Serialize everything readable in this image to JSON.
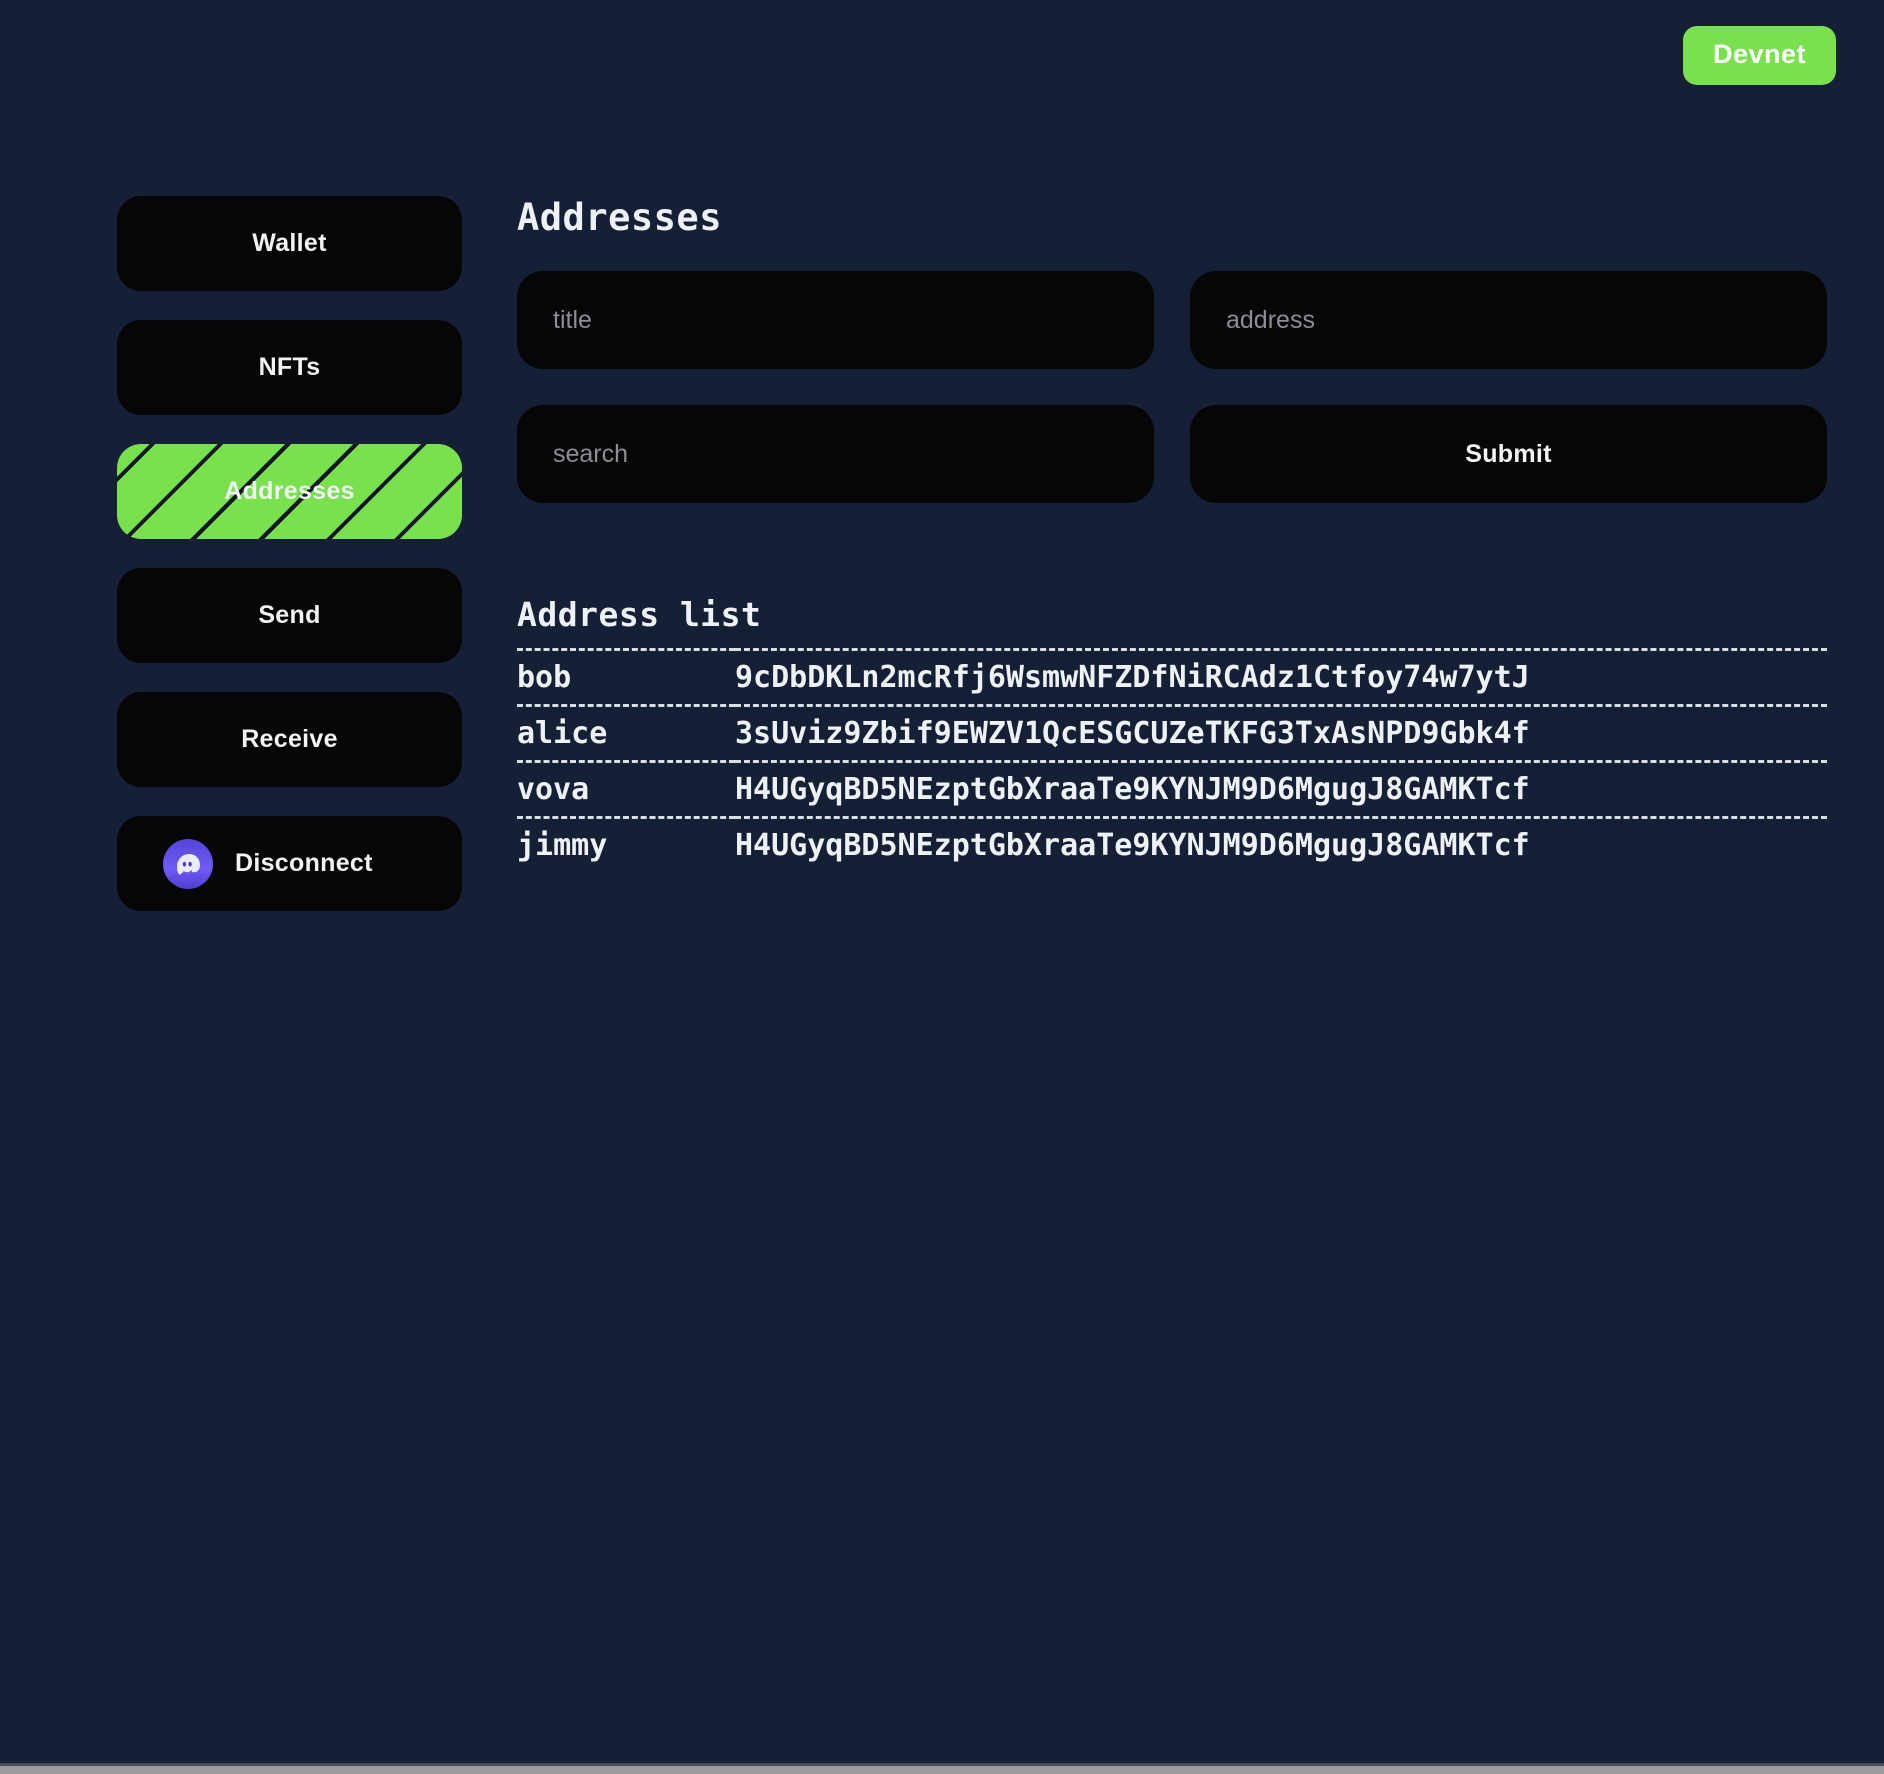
{
  "network": {
    "badge_label": "Devnet",
    "accent_color": "#79e04e"
  },
  "sidebar": {
    "items": [
      {
        "label": "Wallet",
        "active": false,
        "icon": null
      },
      {
        "label": "NFTs",
        "active": false,
        "icon": null
      },
      {
        "label": "Addresses",
        "active": true,
        "icon": null
      },
      {
        "label": "Send",
        "active": false,
        "icon": null
      },
      {
        "label": "Receive",
        "active": false,
        "icon": null
      },
      {
        "label": "Disconnect",
        "active": false,
        "icon": "phantom-ghost-icon"
      }
    ]
  },
  "main": {
    "page_title": "Addresses",
    "form": {
      "title_placeholder": "title",
      "title_value": "",
      "address_placeholder": "address",
      "address_value": "",
      "search_placeholder": "search",
      "search_value": "",
      "submit_label": "Submit"
    },
    "address_list": {
      "heading": "Address list",
      "rows": [
        {
          "name": "bob",
          "address": "9cDbDKLn2mcRfj6WsmwNFZDfNiRCAdz1Ctfoy74w7ytJ"
        },
        {
          "name": "alice",
          "address": "3sUviz9Zbif9EWZV1QcESGCUZeTKFG3TxAsNPD9Gbk4f"
        },
        {
          "name": "vova",
          "address": "H4UGyqBD5NEzptGbXraaTe9KYNJM9D6MgugJ8GAMKTcf"
        },
        {
          "name": "jimmy",
          "address": "H4UGyqBD5NEzptGbXraaTe9KYNJM9D6MgugJ8GAMKTcf"
        }
      ]
    }
  },
  "colors": {
    "background": "#151f36",
    "panel": "#060607",
    "accent_green": "#79e04e",
    "text": "#eef1f6",
    "placeholder": "#8b8e95"
  }
}
